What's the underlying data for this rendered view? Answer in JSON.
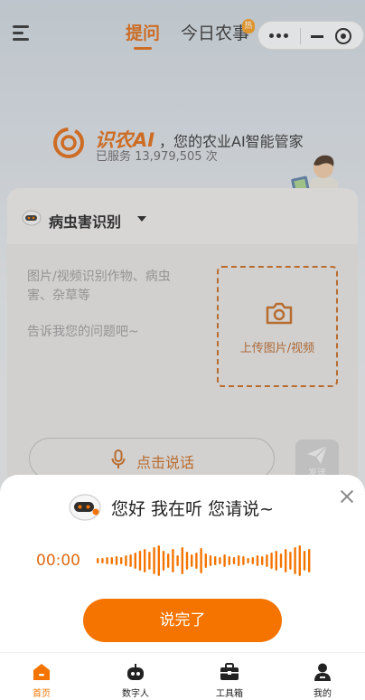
{
  "header": {
    "tabs": [
      {
        "label": "提问",
        "active": true
      },
      {
        "label": "今日农事",
        "badge": "热"
      }
    ]
  },
  "brand": {
    "name": "识农AI",
    "slogan": "，您的农业AI智能管家",
    "served": "已服务 13,979,505 次"
  },
  "card": {
    "mode_label": "病虫害识别",
    "hint_1": "图片/视频识别作物、病虫害、杂草等",
    "hint_2": "告诉我您的问题吧~",
    "upload_label": "上传图片/视频",
    "voice_label": "点击说话",
    "send_label": "发送"
  },
  "voice_sheet": {
    "prompt": "您好 我在听 您请说~",
    "timer": "00:00",
    "done_label": "说完了"
  },
  "tabbar": {
    "items": [
      {
        "label": "首页",
        "icon": "home-icon",
        "active": true
      },
      {
        "label": "数字人",
        "icon": "robot-icon"
      },
      {
        "label": "工具箱",
        "icon": "toolbox-icon"
      },
      {
        "label": "我的",
        "icon": "user-icon"
      }
    ]
  },
  "colors": {
    "accent": "#f57400",
    "brand": "#e06a12"
  }
}
